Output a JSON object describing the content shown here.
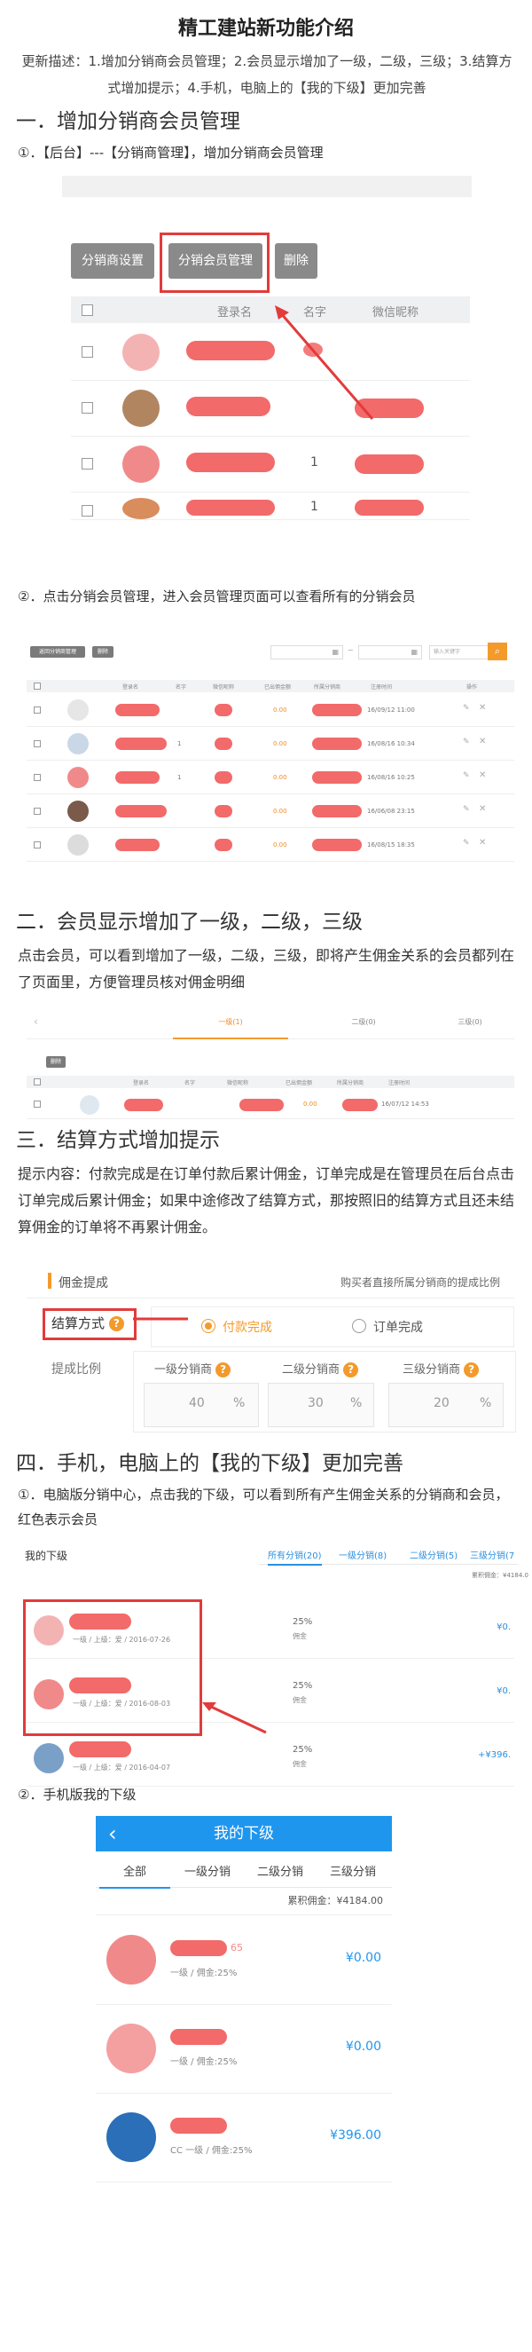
{
  "title": "精工建站新功能介绍",
  "intro": "更新描述：1.增加分销商会员管理；2.会员显示增加了一级，二级，三级；3.结算方式增加提示；4.手机，电脑上的【我的下级】更加完善",
  "sec1": {
    "heading": "一．增加分销商会员管理",
    "step": "①．【后台】---【分销商管理】，增加分销商会员管理",
    "buttons": [
      "分销商设置",
      "分销会员管理",
      "删除"
    ],
    "columns": [
      "登录名",
      "名字",
      "微信昵称"
    ],
    "row_numbers": [
      "1",
      "1"
    ]
  },
  "sec1b": {
    "step": "②．点击分销会员管理，进入会员管理页面可以查看所有的分销会员",
    "top_buttons": [
      "返回分销商管理",
      "删除"
    ],
    "search_placeholder": "输入关键字",
    "range_sep": "~",
    "columns": [
      "登录名",
      "名字",
      "微信昵称",
      "已出佣金额",
      "所属分销商",
      "注册时间",
      "操作"
    ],
    "rows": [
      {
        "name": "",
        "amount": "0.00",
        "date": "16/09/12 11:00"
      },
      {
        "name": "1",
        "amount": "0.00",
        "date": "16/08/16 10:34"
      },
      {
        "name": "1",
        "amount": "0.00",
        "date": "16/08/16 10:25"
      },
      {
        "name": "",
        "amount": "0.00",
        "date": "16/06/08 23:15"
      },
      {
        "name": "",
        "amount": "0.00",
        "date": "16/08/15 18:35"
      }
    ]
  },
  "sec2": {
    "heading": "二．会员显示增加了一级，二级，三级",
    "para": "点击会员，可以看到增加了一级，二级，三级，即将产生佣金关系的会员都列在了页面里，方便管理员核对佣金明细",
    "tabs": [
      "一级(1)",
      "二级(0)",
      "三级(0)"
    ],
    "del": "删除",
    "columns": [
      "登录名",
      "名字",
      "微信昵称",
      "已出佣金额",
      "所属分销商",
      "注册时间"
    ],
    "row": {
      "amount": "0.00",
      "date": "16/07/12 14:53"
    }
  },
  "sec3": {
    "heading": "三．结算方式增加提示",
    "para": "提示内容：付款完成是在订单付款后累计佣金，订单完成是在管理员在后台点击订单完成后累计佣金；如果中途修改了结算方式，那按照旧的结算方式且还未结算佣金的订单将不再累计佣金。",
    "panel_title": "佣金提成",
    "panel_note": "购买者直接所属分销商的提成比例",
    "settle_label": "结算方式",
    "opt_paid": "付款完成",
    "opt_done": "订单完成",
    "ratio_label": "提成比例",
    "levels": [
      {
        "label": "一级分销商",
        "value": "40"
      },
      {
        "label": "二级分销商",
        "value": "30"
      },
      {
        "label": "三级分销商",
        "value": "20"
      }
    ],
    "pct": "%"
  },
  "sec4": {
    "heading": "四．手机，电脑上的【我的下级】更加完善",
    "step": "①．电脑版分销中心，点击我的下级，可以看到所有产生佣金关系的分销商和会员，红色表示会员",
    "pc_title": "我的下级",
    "pc_tabs": [
      "所有分销(20)",
      "一级分销(8)",
      "二级分销(5)",
      "三级分销(7"
    ],
    "pc_total": "累积佣金：¥4184.0",
    "pc_rows": [
      {
        "meta": "一级 / 上级：爱 / 2016-07-26",
        "pct": "25%",
        "sub": "佣金",
        "amt": "¥0."
      },
      {
        "meta": "一级 / 上级：爱 / 2016-08-03",
        "pct": "25%",
        "sub": "佣金",
        "amt": "¥0."
      },
      {
        "meta": "一级 / 上级：爱 / 2016-04-07",
        "pct": "25%",
        "sub": "佣金",
        "amt": "+¥396."
      }
    ],
    "step2": "②．手机版我的下级",
    "m_title": "我的下级",
    "m_back": "‹",
    "m_tabs": [
      "全部",
      "一级分销",
      "二级分销",
      "三级分销"
    ],
    "m_total": "累积佣金：¥4184.00",
    "m_rows": [
      {
        "suffix": "65",
        "meta": "一级 / 佣金:25%",
        "amt": "¥0.00"
      },
      {
        "suffix": "",
        "meta": "一级 / 佣金:25%",
        "amt": "¥0.00"
      },
      {
        "suffix": "",
        "meta": "CC 一级 / 佣金:25%",
        "amt": "¥396.00"
      }
    ]
  },
  "colors": {
    "accent_red": "#e23b3b",
    "blue": "#1f96ee",
    "orange": "#f39a2b"
  }
}
